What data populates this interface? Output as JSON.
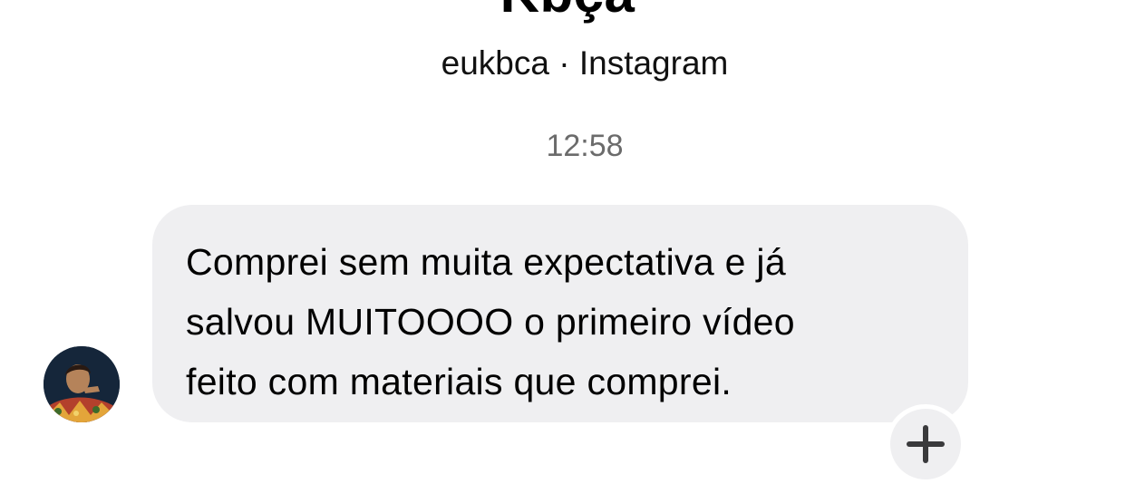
{
  "header": {
    "name": "Kbça",
    "subtitle": "eukbca · Instagram"
  },
  "conversation": {
    "timestamp": "12:58",
    "messages": [
      {
        "lines": [
          "Comprei sem muita expectativa e já",
          "salvou MUITOOOO o primeiro vídeo",
          "feito com materiais que comprei."
        ]
      }
    ]
  },
  "icons": {
    "react": "plus-icon",
    "avatar": "avatar"
  },
  "colors": {
    "bubble": "#efeff1",
    "timestamp": "#6b6b6b",
    "background": "#ffffff"
  }
}
